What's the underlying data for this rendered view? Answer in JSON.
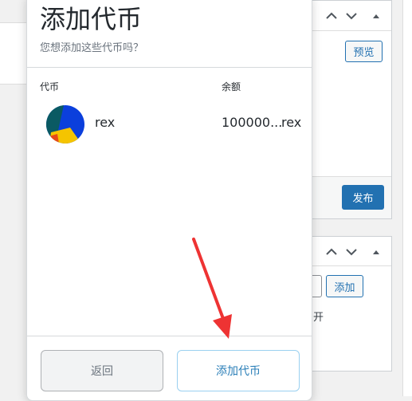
{
  "popup": {
    "title": "添加代币",
    "subtitle": "您想添加这些代币吗？",
    "columns": {
      "token": "代币",
      "balance": "余额"
    },
    "tokens": [
      {
        "name": "rex",
        "balance": "100000...",
        "symbol": "rex",
        "icon": "token-identicon"
      }
    ],
    "buttons": {
      "back": "返回",
      "add": "添加代币"
    }
  },
  "background": {
    "publish_box": {
      "preview_label": "预览",
      "publish_label": "发布"
    },
    "second_box": {
      "add_label": "添加",
      "partial_text": "开"
    }
  },
  "colors": {
    "wp_primary": "#2271b1",
    "add_token_text": "#2b7fb8",
    "annotation_arrow": "#ee3333"
  },
  "icons": {
    "box_controls": [
      "chevron-up-icon",
      "chevron-down-icon",
      "triangle-up-icon"
    ]
  }
}
